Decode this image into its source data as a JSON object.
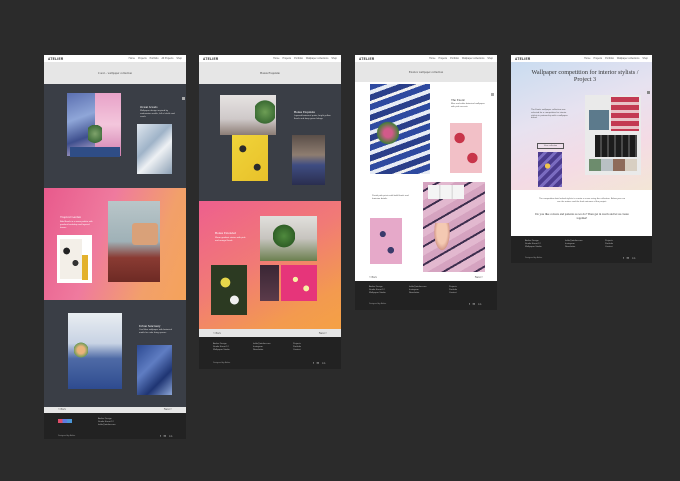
{
  "site": {
    "logo": "ATELIER",
    "menu": [
      "Home",
      "Projects",
      "Portfolio",
      "All Projects",
      "Wallpaper collections",
      "Shop"
    ]
  },
  "mockup1": {
    "header": "Coral – wallpaper collection",
    "sec1_title": "Ocean Jewels",
    "sec1_text": "Wallpaper design inspired by underwater worlds, full of shells and corals",
    "sec2_title": "Tropical Garden",
    "sec2_text": "Bold florals in a warm palette with gradient backdrop and layered leaves",
    "sec3_title": "Urban Sanctuary",
    "sec3_text": "Cool blue wallpaper with botanical motifs for calm living spaces",
    "prev": "< Prev",
    "next": "Next >",
    "footer_col1": [
      "Atelier Design",
      "Studio Street 12",
      "Wallpaper Studio"
    ],
    "footer_col2": [
      "hello@atelier.com",
      "Instagram",
      "Newsletter"
    ],
    "social": "f ✉ in",
    "powered": "Designed by Atelier"
  },
  "mockup2": {
    "header": "Bonus Exquisite",
    "sec1_title": "Bonus Exquisite",
    "sec1_text": "Layered botanical prints, bright yellow florals and deep green foliage",
    "sec2_title": "Bonus Extended",
    "sec2_text": "Warm gradient stories with pink and orange florals",
    "prev": "< Prev",
    "next": "Next >",
    "footer_col1": [
      "Atelier Design",
      "Studio Street 12",
      "Wallpaper Studio"
    ],
    "footer_col2": [
      "hello@atelier.com",
      "Instagram",
      "Newsletter"
    ],
    "footer_col3": [
      "Projects",
      "Portfolio",
      "Contact"
    ],
    "social": "f ✉ in",
    "powered": "Designed by Atelier"
  },
  "mockup3": {
    "header": "Exotica wallpaper collection",
    "sec1_title": "The Exotic",
    "sec1_text": "Blue and white botanical wallpaper with pink accents",
    "sec2_text": "Pastel pink prints with bold florals and feminine details",
    "prev": "< Prev",
    "next": "Next >",
    "footer_col1": [
      "Atelier Design",
      "Studio Street 12",
      "Wallpaper Studio"
    ],
    "footer_col2": [
      "hello@atelier.com",
      "Instagram",
      "Newsletter"
    ],
    "footer_col3": [
      "Projects",
      "Portfolio",
      "Contact"
    ],
    "social": "f ✉ in",
    "powered": "Designed by Atelier"
  },
  "mockup4": {
    "hero_title": "Wallpaper competition for interior stylists / Project 3",
    "hero_text": "The Exotic wallpaper collection was selected for a competition for interior stylists in partnership with a wallpaper brand.",
    "hero_button": "View collection",
    "body_text": "The competition brief asked stylists to create a scene using the collection. Below you can see the entries and the final outcome of the project.",
    "question": "Do you like colours and patterns as we do? Then get in touch and let us create together!",
    "footer_col1": [
      "Atelier Design",
      "Studio Street 12",
      "Wallpaper Studio"
    ],
    "footer_col2": [
      "hello@atelier.com",
      "Instagram",
      "Newsletter"
    ],
    "footer_col3": [
      "Projects",
      "Portfolio",
      "Contact"
    ],
    "social": "f ✉ in",
    "powered": "Designed by Atelier"
  }
}
